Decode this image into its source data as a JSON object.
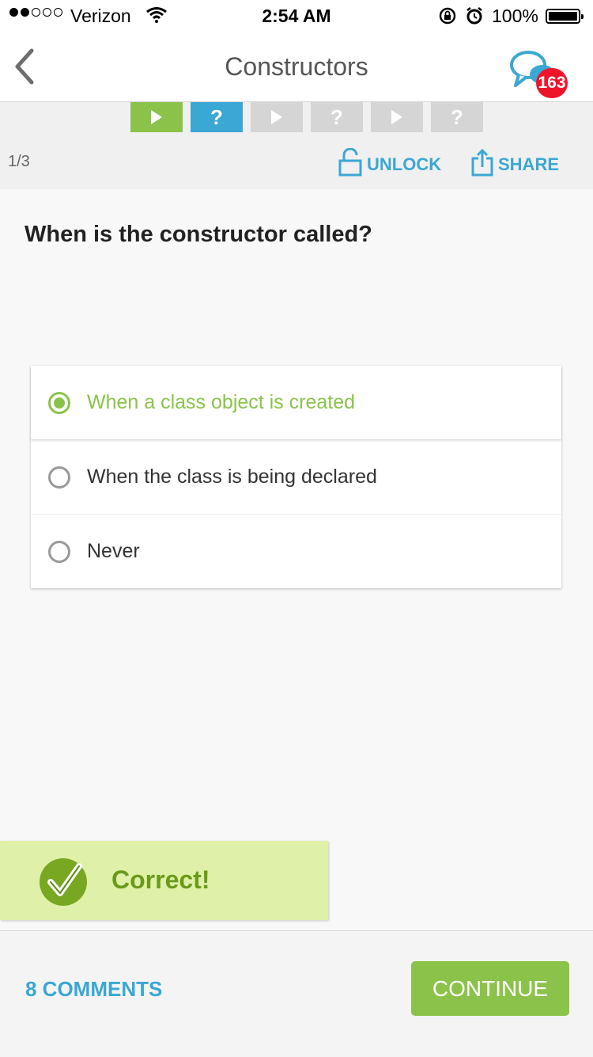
{
  "status_bar": {
    "carrier": "Verizon",
    "time": "2:54 AM",
    "battery": "100%",
    "signal_bars_filled": 2,
    "signal_bars_total": 5
  },
  "nav": {
    "back_icon": "chevron-left-icon",
    "title": "Constructors",
    "chat_icon": "chat-bubbles-icon",
    "badge_count": "163"
  },
  "steps": [
    {
      "type": "video",
      "state": "done",
      "glyph": "play"
    },
    {
      "type": "question",
      "state": "current",
      "glyph": "?"
    },
    {
      "type": "video",
      "state": "pending",
      "glyph": "play"
    },
    {
      "type": "question",
      "state": "pending",
      "glyph": "?"
    },
    {
      "type": "video",
      "state": "pending",
      "glyph": "play"
    },
    {
      "type": "question",
      "state": "pending",
      "glyph": "?"
    }
  ],
  "toolbar": {
    "counter": "1/3",
    "unlock_label": "UNLOCK",
    "share_label": "SHARE"
  },
  "question": {
    "text": "When is the constructor called?"
  },
  "options": [
    {
      "label": "When a class object is created",
      "selected": true
    },
    {
      "label": "When the class is being declared",
      "selected": false
    },
    {
      "label": "Never",
      "selected": false
    }
  ],
  "feedback": {
    "text": "Correct!"
  },
  "bottom": {
    "comments_label": "8 COMMENTS",
    "continue_label": "CONTINUE"
  },
  "colors": {
    "green": "#8bc34a",
    "blue": "#3ba7d3",
    "badge_red": "#f0142a",
    "feedback_bg": "#dff0a8"
  }
}
